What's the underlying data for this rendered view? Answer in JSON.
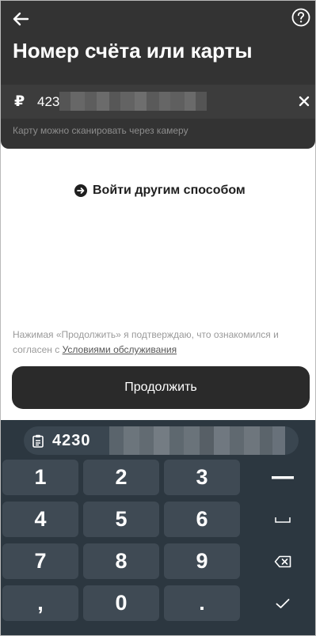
{
  "header": {
    "title": "Номер счёта или карты",
    "back_icon": "arrow-left-icon",
    "help_icon": "question-circle-icon"
  },
  "account": {
    "currency_symbol": "₽",
    "value_prefix": "423",
    "clear_icon": "close-icon",
    "hint": "Карту можно сканировать через камеру"
  },
  "alt_login": {
    "icon": "arrow-right-circle-icon",
    "label": "Войти другим способом"
  },
  "terms": {
    "text": "Нажимая «Продолжить» я подтверждаю, что ознакомился и согласен с ",
    "link": "Условиями обслуживания"
  },
  "continue_button": {
    "label": "Продолжить"
  },
  "keyboard": {
    "suggestion": {
      "icon": "clipboard-icon",
      "prefix": "4230"
    },
    "keys": [
      [
        "1",
        "2",
        "3"
      ],
      [
        "4",
        "5",
        "6"
      ],
      [
        "7",
        "8",
        "9"
      ],
      [
        ",",
        "0",
        "."
      ]
    ],
    "function_keys": [
      "minus-icon",
      "space-icon",
      "backspace-icon",
      "checkmark-icon"
    ]
  },
  "colors": {
    "header_bg": "#333333",
    "keyboard_bg": "#2c3740",
    "key_bg": "#3f4a54",
    "button_bg": "#2a2a2a"
  }
}
